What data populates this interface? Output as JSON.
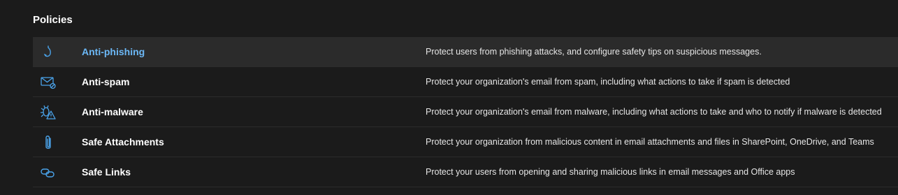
{
  "section": {
    "title": "Policies"
  },
  "accent_color": "#6cb8f6",
  "policies": [
    {
      "name": "Anti-phishing",
      "description": "Protect users from phishing attacks, and configure safety tips on suspicious messages.",
      "icon": "fishing-hook-icon",
      "selected": true
    },
    {
      "name": "Anti-spam",
      "description": "Protect your organization's email from spam, including what actions to take if spam is detected",
      "icon": "mail-block-icon",
      "selected": false
    },
    {
      "name": "Anti-malware",
      "description": "Protect your organization's email from malware, including what actions to take and who to notify if malware is detected",
      "icon": "bug-warning-icon",
      "selected": false
    },
    {
      "name": "Safe Attachments",
      "description": "Protect your organization from malicious content in email attachments and files in SharePoint, OneDrive, and Teams",
      "icon": "paperclip-icon",
      "selected": false
    },
    {
      "name": "Safe Links",
      "description": "Protect your users from opening and sharing malicious links in email messages and Office apps",
      "icon": "link-icon",
      "selected": false
    }
  ]
}
